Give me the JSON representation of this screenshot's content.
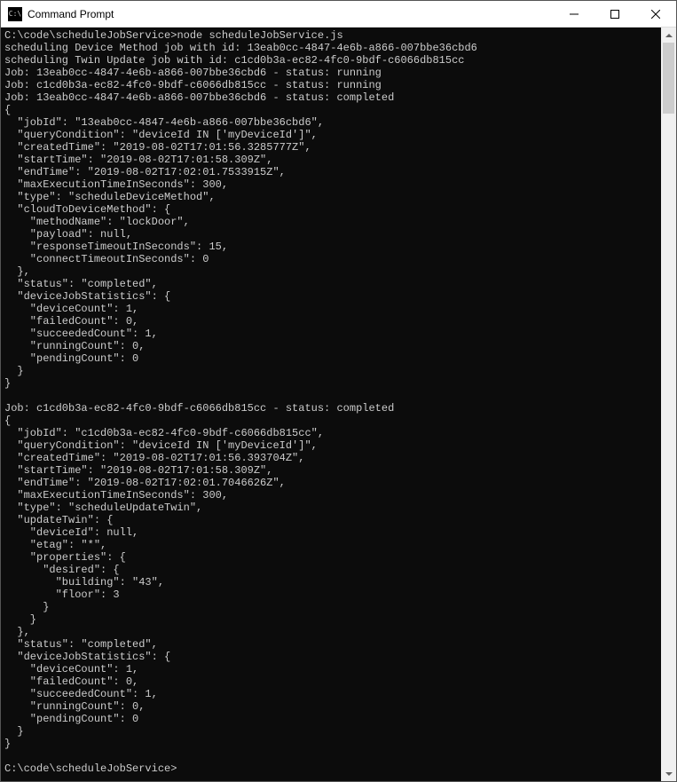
{
  "window": {
    "title": "Command Prompt"
  },
  "console": {
    "prompt_path": "C:\\code\\scheduleJobService>",
    "command": "node scheduleJobService.js",
    "log_lines": [
      "scheduling Device Method job with id: 13eab0cc-4847-4e6b-a866-007bbe36cbd6",
      "scheduling Twin Update job with id: c1cd0b3a-ec82-4fc0-9bdf-c6066db815cc",
      "Job: 13eab0cc-4847-4e6b-a866-007bbe36cbd6 - status: running",
      "Job: c1cd0b3a-ec82-4fc0-9bdf-c6066db815cc - status: running",
      "Job: 13eab0cc-4847-4e6b-a866-007bbe36cbd6 - status: completed"
    ],
    "job1_json": "{\n  \"jobId\": \"13eab0cc-4847-4e6b-a866-007bbe36cbd6\",\n  \"queryCondition\": \"deviceId IN ['myDeviceId']\",\n  \"createdTime\": \"2019-08-02T17:01:56.3285777Z\",\n  \"startTime\": \"2019-08-02T17:01:58.309Z\",\n  \"endTime\": \"2019-08-02T17:02:01.7533915Z\",\n  \"maxExecutionTimeInSeconds\": 300,\n  \"type\": \"scheduleDeviceMethod\",\n  \"cloudToDeviceMethod\": {\n    \"methodName\": \"lockDoor\",\n    \"payload\": null,\n    \"responseTimeoutInSeconds\": 15,\n    \"connectTimeoutInSeconds\": 0\n  },\n  \"status\": \"completed\",\n  \"deviceJobStatistics\": {\n    \"deviceCount\": 1,\n    \"failedCount\": 0,\n    \"succeededCount\": 1,\n    \"runningCount\": 0,\n    \"pendingCount\": 0\n  }\n}",
    "job2_header": "Job: c1cd0b3a-ec82-4fc0-9bdf-c6066db815cc - status: completed",
    "job2_json": "{\n  \"jobId\": \"c1cd0b3a-ec82-4fc0-9bdf-c6066db815cc\",\n  \"queryCondition\": \"deviceId IN ['myDeviceId']\",\n  \"createdTime\": \"2019-08-02T17:01:56.393704Z\",\n  \"startTime\": \"2019-08-02T17:01:58.309Z\",\n  \"endTime\": \"2019-08-02T17:02:01.7046626Z\",\n  \"maxExecutionTimeInSeconds\": 300,\n  \"type\": \"scheduleUpdateTwin\",\n  \"updateTwin\": {\n    \"deviceId\": null,\n    \"etag\": \"*\",\n    \"properties\": {\n      \"desired\": {\n        \"building\": \"43\",\n        \"floor\": 3\n      }\n    }\n  },\n  \"status\": \"completed\",\n  \"deviceJobStatistics\": {\n    \"deviceCount\": 1,\n    \"failedCount\": 0,\n    \"succeededCount\": 1,\n    \"runningCount\": 0,\n    \"pendingCount\": 0\n  }\n}",
    "final_prompt": "C:\\code\\scheduleJobService>"
  }
}
